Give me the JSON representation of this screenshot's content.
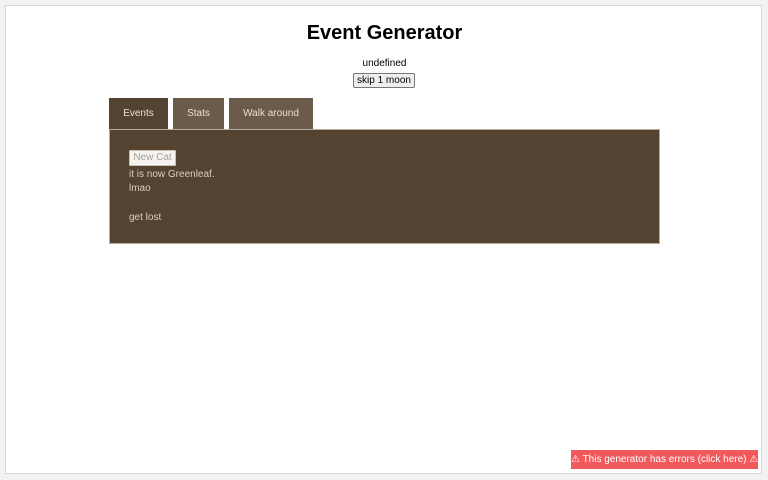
{
  "header": {
    "title": "Event Generator",
    "subtitle": "undefined",
    "skip_button_label": "skip 1 moon"
  },
  "tabs": [
    {
      "label": "Events",
      "active": true
    },
    {
      "label": "Stats",
      "active": false
    },
    {
      "label": "Walk around",
      "active": false
    }
  ],
  "events_panel": {
    "new_cat_button_label": "New Cat",
    "lines": [
      "it is now Greenleaf.",
      "lmao",
      "get lost"
    ]
  },
  "error_banner": {
    "text": "⚠ This generator has errors (click here) ⚠"
  },
  "colors": {
    "panel_background": "#534330",
    "inactive_tab": "#6b5b4b",
    "error_banner": "#f2595c"
  }
}
